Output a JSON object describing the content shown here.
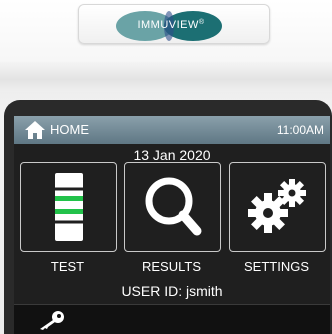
{
  "device": {
    "brand": "IMMUVIEW",
    "brand_mark": "®"
  },
  "header": {
    "home_label": "HOME",
    "time": "11:00AM",
    "home_icon": "home-icon"
  },
  "main": {
    "date": "13 Jan 2020",
    "tiles": [
      {
        "label": "TEST",
        "icon": "test-strip-icon"
      },
      {
        "label": "RESULTS",
        "icon": "magnifier-icon"
      },
      {
        "label": "SETTINGS",
        "icon": "gears-icon"
      }
    ],
    "user_id": "USER ID: jsmith"
  },
  "footer": {
    "icon": "key-icon"
  },
  "colors": {
    "header_bar": "#7f97a3",
    "screen_bg": "#1f1f1f",
    "accent_green": "#22c24a",
    "brand_teal": "#1c6f73"
  }
}
